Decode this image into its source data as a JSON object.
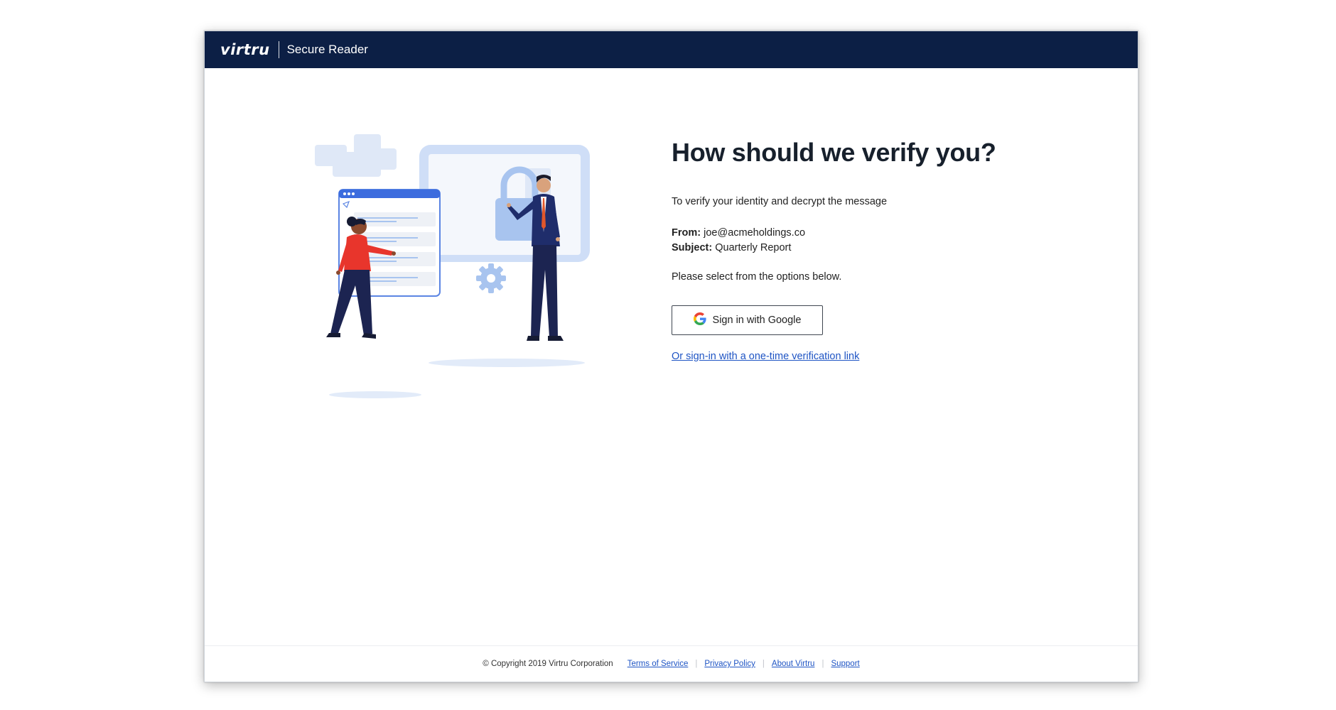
{
  "header": {
    "logo_text": "virtru",
    "product_name": "Secure Reader",
    "bg_color": "#0c1f45"
  },
  "main": {
    "heading": "How should we verify you?",
    "intro": "To verify your identity and decrypt the message",
    "from_label": "From:",
    "from_value": "joe@acmeholdings.co",
    "subject_label": "Subject:",
    "subject_value": "Quarterly Report",
    "instruction": "Please select from the options below.",
    "google_button_label": "Sign in with Google",
    "google_icon": "google-g-icon",
    "alt_link": "Or sign-in with a one-time verification link",
    "link_color": "#1e54c4"
  },
  "footer": {
    "copyright": "© Copyright 2019 Virtru Corporation",
    "links": [
      "Terms of Service",
      "Privacy Policy",
      "About Virtru",
      "Support"
    ]
  }
}
